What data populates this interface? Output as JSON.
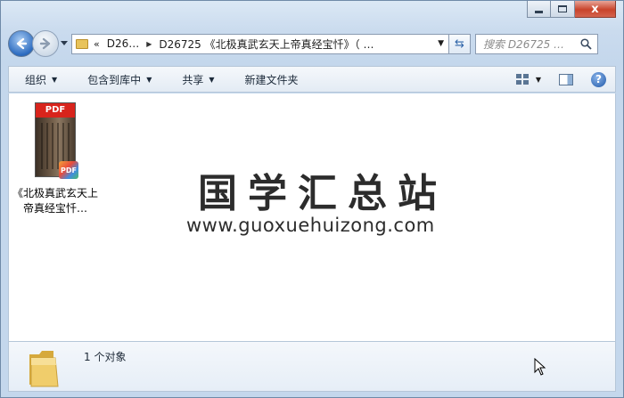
{
  "window": {
    "controls": {
      "close_glyph": "x"
    }
  },
  "nav": {
    "address": {
      "crumb_prefix": "«",
      "crumb_1": "D26…",
      "crumb_2": "D26725 《北极真武玄天上帝真经宝忏》（ …"
    },
    "search": {
      "placeholder": "搜索 D26725 …"
    }
  },
  "commandbar": {
    "organize": "组织",
    "include_in_library": "包含到库中",
    "share": "共享",
    "new_folder": "新建文件夹"
  },
  "content": {
    "files": [
      {
        "name": "《北极真武玄天上帝真经宝忏…",
        "type": "pdf",
        "badge": "PDF",
        "icon": "pdf-file-icon"
      }
    ],
    "watermark": {
      "title": "国学汇总站",
      "url": "www.guoxuehuizong.com"
    }
  },
  "details": {
    "count_text": "1 个对象"
  },
  "colors": {
    "accent": "#2d6cc0",
    "pdf_red": "#d8241c",
    "folder": "#e8c35a"
  }
}
